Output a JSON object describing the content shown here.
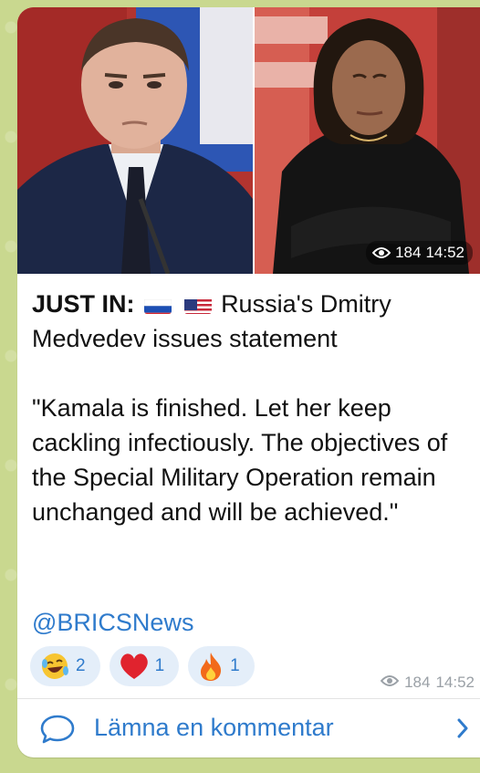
{
  "message": {
    "headline_bold": "JUST IN:",
    "headline_rest": "Russia's Dmitry Medvedev issues statement",
    "quote": "\"Kamala is finished. Let her keep cackling infectiously. The objectives of the Special Military Operation remain unchanged and will be achieved.\"",
    "handle": "@BRICSNews",
    "views": "184",
    "time": "14:52"
  },
  "media": {
    "views": "184",
    "time": "14:52"
  },
  "reactions": [
    {
      "emoji": "laughing-emoji",
      "count": "2"
    },
    {
      "emoji": "red-heart-emoji",
      "count": "1"
    },
    {
      "emoji": "fire-emoji",
      "count": "1"
    }
  ],
  "comments": {
    "label": "Lämna en kommentar"
  },
  "colors": {
    "link": "#2f7bcc",
    "reaction_bg": "#e4eef9",
    "wallpaper": "#c9d88f"
  }
}
